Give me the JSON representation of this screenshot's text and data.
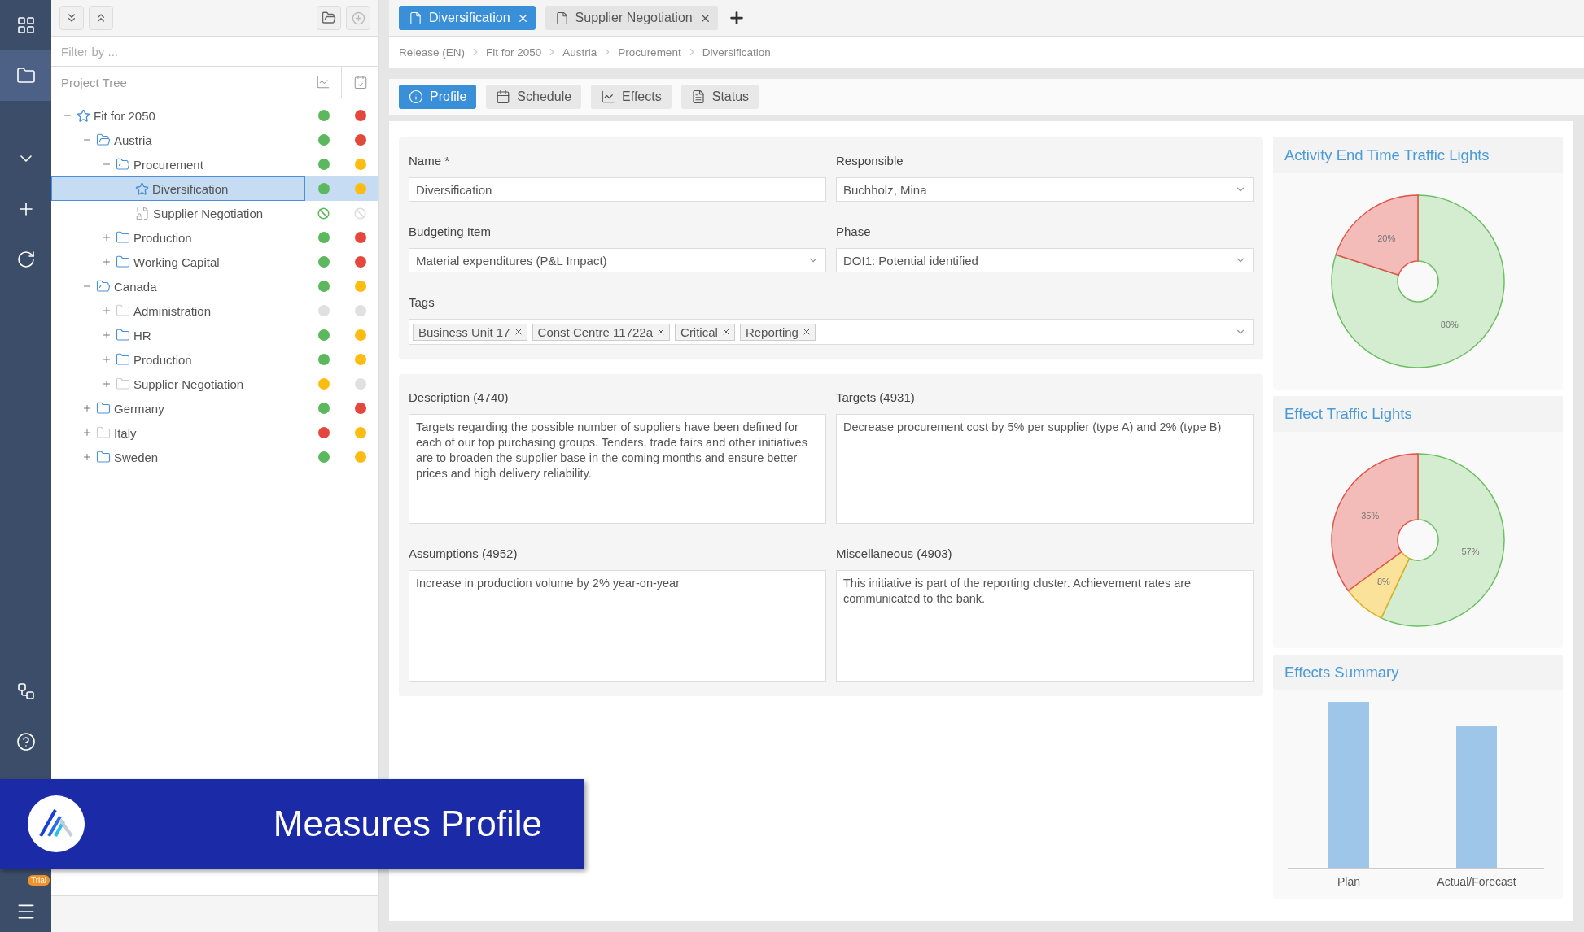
{
  "rail": [
    {
      "selected": false
    },
    {
      "selected": true
    },
    {
      "selected": false
    },
    {
      "selected": false
    },
    {
      "selected": false
    },
    {
      "selected": false
    },
    {
      "selected": false
    }
  ],
  "rail_footer": {
    "badge": "Trial"
  },
  "tree_panel": {
    "filter_placeholder": "Filter by ...",
    "header": "Project Tree"
  },
  "tree": [
    {
      "label": "Fit for 2050",
      "kind": "star",
      "expanded": true,
      "selected": false,
      "lights": [
        {
          "kind": "dot",
          "color": "#5cb85c"
        },
        {
          "kind": "dot",
          "color": "#e4473c"
        }
      ],
      "children": [
        {
          "label": "Austria",
          "kind": "folder",
          "expanded": true,
          "selected": false,
          "muted": false,
          "lights": [
            {
              "kind": "dot",
              "color": "#5cb85c"
            },
            {
              "kind": "dot",
              "color": "#e4473c"
            }
          ],
          "children": [
            {
              "label": "Procurement",
              "kind": "folder",
              "expanded": true,
              "selected": false,
              "muted": false,
              "lights": [
                {
                  "kind": "dot",
                  "color": "#5cb85c"
                },
                {
                  "kind": "dot",
                  "color": "#fdbc11"
                }
              ],
              "children": [
                {
                  "label": "Diversification",
                  "kind": "star",
                  "selected": true,
                  "lights": [
                    {
                      "kind": "dot",
                      "color": "#5cb85c"
                    },
                    {
                      "kind": "dot",
                      "color": "#fdbc11"
                    }
                  ]
                },
                {
                  "label": "Supplier Negotiation",
                  "kind": "locked-document",
                  "selected": false,
                  "lights": [
                    {
                      "kind": "slashed",
                      "color": "#5cb85c"
                    },
                    {
                      "kind": "slashed",
                      "color": "#dddddd"
                    }
                  ]
                }
              ]
            },
            {
              "label": "Production",
              "kind": "folder",
              "expanded": false,
              "selected": false,
              "muted": false,
              "lights": [
                {
                  "kind": "dot",
                  "color": "#5cb85c"
                },
                {
                  "kind": "dot",
                  "color": "#e4473c"
                }
              ]
            },
            {
              "label": "Working Capital",
              "kind": "folder",
              "expanded": false,
              "selected": false,
              "muted": false,
              "lights": [
                {
                  "kind": "dot",
                  "color": "#5cb85c"
                },
                {
                  "kind": "dot",
                  "color": "#e4473c"
                }
              ]
            }
          ]
        },
        {
          "label": "Canada",
          "kind": "folder",
          "expanded": true,
          "selected": false,
          "muted": false,
          "lights": [
            {
              "kind": "dot",
              "color": "#5cb85c"
            },
            {
              "kind": "dot",
              "color": "#fdbc11"
            }
          ],
          "children": [
            {
              "label": "Administration",
              "kind": "folder",
              "expanded": false,
              "selected": false,
              "muted": true,
              "lights": [
                {
                  "kind": "dot",
                  "color": "#e0e0e0"
                },
                {
                  "kind": "dot",
                  "color": "#e0e0e0"
                }
              ]
            },
            {
              "label": "HR",
              "kind": "folder",
              "expanded": false,
              "selected": false,
              "muted": false,
              "lights": [
                {
                  "kind": "dot",
                  "color": "#5cb85c"
                },
                {
                  "kind": "dot",
                  "color": "#fdbc11"
                }
              ]
            },
            {
              "label": "Production",
              "kind": "folder",
              "expanded": false,
              "selected": false,
              "muted": false,
              "lights": [
                {
                  "kind": "dot",
                  "color": "#5cb85c"
                },
                {
                  "kind": "dot",
                  "color": "#fdbc11"
                }
              ]
            },
            {
              "label": "Supplier Negotiation",
              "kind": "folder",
              "expanded": false,
              "selected": false,
              "muted": true,
              "lights": [
                {
                  "kind": "dot",
                  "color": "#fdbc11"
                },
                {
                  "kind": "dot",
                  "color": "#e0e0e0"
                }
              ]
            }
          ]
        },
        {
          "label": "Germany",
          "kind": "folder",
          "expanded": false,
          "selected": false,
          "muted": false,
          "lights": [
            {
              "kind": "dot",
              "color": "#5cb85c"
            },
            {
              "kind": "dot",
              "color": "#e4473c"
            }
          ]
        },
        {
          "label": "Italy",
          "kind": "folder",
          "expanded": false,
          "selected": false,
          "muted": true,
          "lights": [
            {
              "kind": "dot",
              "color": "#e4473c"
            },
            {
              "kind": "dot",
              "color": "#fdbc11"
            }
          ]
        },
        {
          "label": "Sweden",
          "kind": "folder",
          "expanded": false,
          "selected": false,
          "muted": false,
          "lights": [
            {
              "kind": "dot",
              "color": "#5cb85c"
            },
            {
              "kind": "dot",
              "color": "#fdbc11"
            }
          ]
        }
      ]
    }
  ],
  "doc_tabs": [
    {
      "label": "Diversification",
      "selected": true
    },
    {
      "label": "Supplier Negotiation",
      "selected": false
    }
  ],
  "breadcrumb": [
    "Release (EN)",
    "Fit for 2050",
    "Austria",
    "Procurement",
    "Diversification"
  ],
  "section_tabs": [
    {
      "label": "Profile",
      "selected": true
    },
    {
      "label": "Schedule",
      "selected": false
    },
    {
      "label": "Effects",
      "selected": false
    },
    {
      "label": "Status",
      "selected": false
    }
  ],
  "form": {
    "fields": [
      {
        "label": "Name *",
        "value": "Diversification",
        "kind": "text"
      },
      {
        "label": "Responsible",
        "value": "Buchholz, Mina",
        "kind": "select"
      },
      {
        "label": "Budgeting Item",
        "value": "Material expenditures (P&L Impact)",
        "kind": "select"
      },
      {
        "label": "Phase",
        "value": "DOI1: Potential identified",
        "kind": "select"
      }
    ],
    "tags": {
      "label": "Tags",
      "items": [
        "Business Unit 17",
        "Const Centre 11722a",
        "Critical",
        "Reporting"
      ]
    }
  },
  "texts": [
    {
      "label": "Description (4740)",
      "value": "Targets regarding the possible number of suppliers have been defined for each of our top purchasing groups. Tenders, trade fairs and other initiatives are to broaden the supplier base in the coming months and ensure better prices and high delivery reliability."
    },
    {
      "label": "Targets (4931)",
      "value": "Decrease procurement cost by 5% per supplier (type A) and 2% (type B)"
    },
    {
      "label": "Assumptions (4952)",
      "value": "Increase in production volume by 2% year-on-year"
    },
    {
      "label": "Miscellaneous (4903)",
      "value": "This initiative is part of the reporting cluster. Achievement rates are communicated to the bank."
    }
  ],
  "charts": [
    {
      "title": "Activity End Time Traffic Lights",
      "chart_data": {
        "type": "donut",
        "values": [
          80,
          20
        ],
        "data_labels": true,
        "value_labels": [
          "80%",
          "20%"
        ]
      }
    },
    {
      "title": "Effect Traffic Lights",
      "chart_data": {
        "type": "donut",
        "values": [
          57,
          8,
          35
        ],
        "data_labels": true,
        "value_labels": [
          "57%",
          "8%",
          "35%"
        ]
      }
    }
  ],
  "effects_summary": {
    "title": "Effects Summary",
    "categories": [
      "Plan",
      "Actual/Forecast"
    ]
  },
  "banner": {
    "title": "Measures Profile"
  }
}
